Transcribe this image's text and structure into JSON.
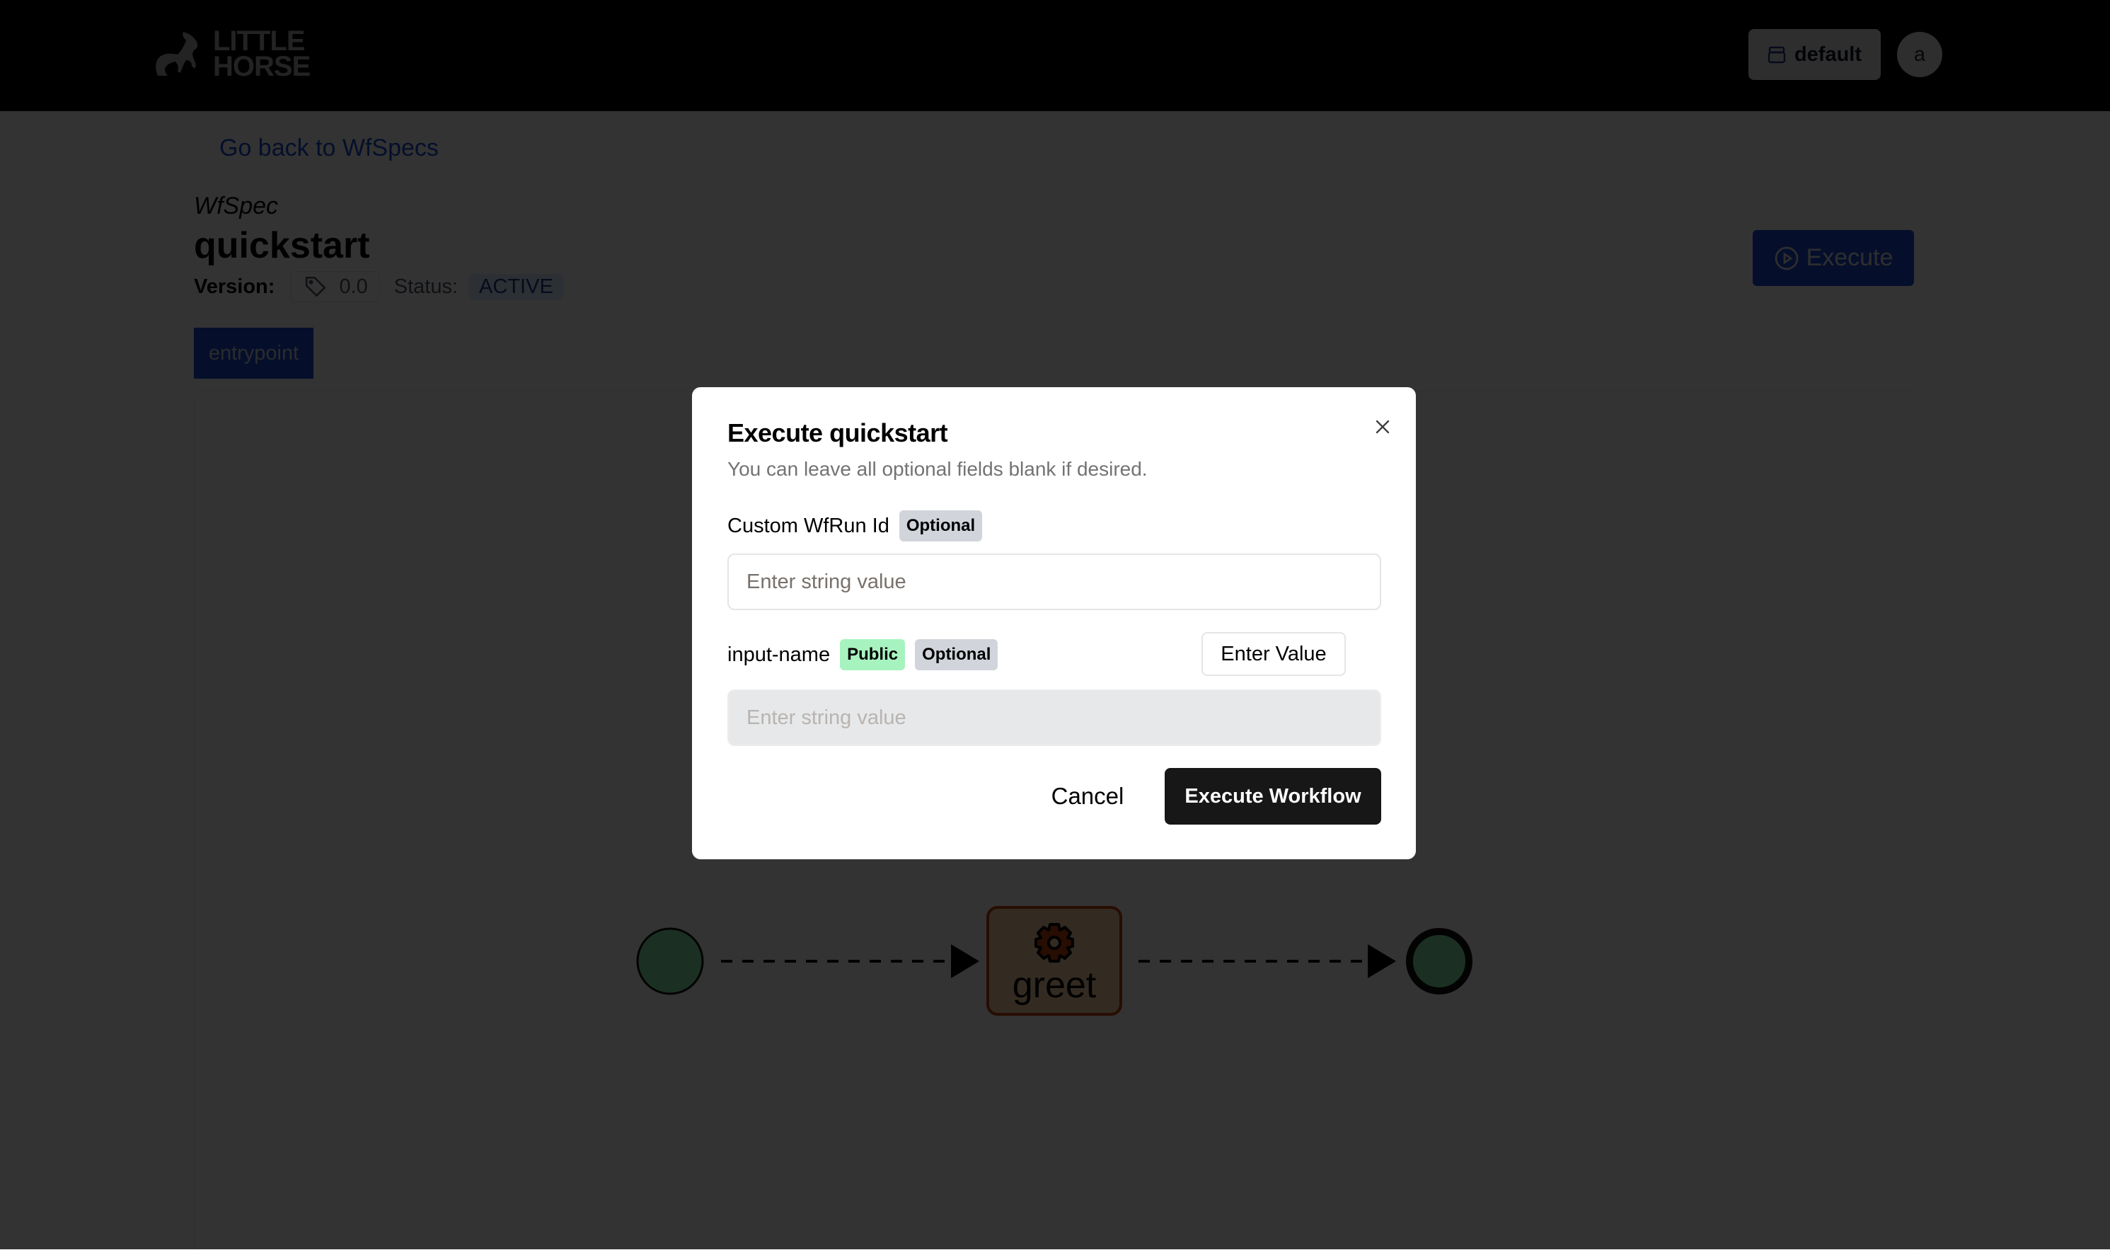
{
  "navbar": {
    "logo_line1": "LITTLE",
    "logo_line2": "HORSE",
    "namespace_label": "default",
    "namespace_icon": "archive-icon",
    "avatar_initial": "a"
  },
  "page": {
    "back_link": "Go back to WfSpecs",
    "spec_kind": "WfSpec",
    "spec_name": "quickstart",
    "version_label": "Version:",
    "version_value": "0.0",
    "status_label": "Status:",
    "status_value": "ACTIVE",
    "execute_label": "Execute",
    "tabs": [
      {
        "label": "entrypoint",
        "active": true
      }
    ]
  },
  "diagram": {
    "nodes": [
      {
        "type": "entrypoint",
        "label": ""
      },
      {
        "type": "task",
        "label": "greet",
        "icon": "gear-icon"
      },
      {
        "type": "exit",
        "label": ""
      }
    ],
    "colors": {
      "start_fill": "#86efac",
      "task_fill": "#fed7aa",
      "task_stroke": "#c2410c",
      "edge": "#000000"
    }
  },
  "modal": {
    "title": "Execute quickstart",
    "description": "You can leave all optional fields blank if desired.",
    "fields": [
      {
        "label": "Custom WfRun Id",
        "badges": [
          "Optional"
        ],
        "placeholder": "Enter string value",
        "value": ""
      },
      {
        "label": "input-name",
        "badges": [
          "Public",
          "Optional"
        ],
        "placeholder": "Enter string value",
        "value": "",
        "toggle_label": "Enter Value"
      }
    ],
    "cancel_label": "Cancel",
    "submit_label": "Execute Workflow"
  }
}
